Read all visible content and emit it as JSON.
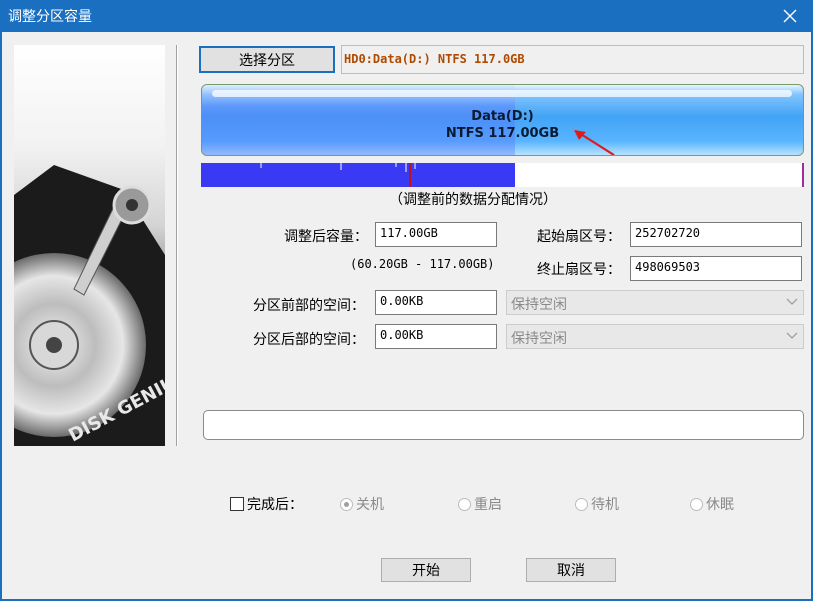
{
  "window": {
    "title": "调整分区容量"
  },
  "toolbar": {
    "select_partition_label": "选择分区"
  },
  "partition": {
    "info": "HD0:Data(D:) NTFS 117.0GB",
    "name": "Data(D:)",
    "fs_size": "NTFS 117.00GB",
    "used_fraction": 0.52
  },
  "map": {
    "caption": "（调整前的数据分配情况）"
  },
  "side": {
    "brand_text": "DISK GENIUS"
  },
  "form": {
    "size_label": "调整后容量：",
    "size_value": "117.00GB",
    "size_range": "(60.20GB - 117.00GB)",
    "start_sector_label": "起始扇区号：",
    "start_sector_value": "252702720",
    "end_sector_label": "终止扇区号：",
    "end_sector_value": "498069503",
    "before_label": "分区前部的空间：",
    "before_value": "0.00KB",
    "before_option": "保持空闲",
    "after_label": "分区后部的空间：",
    "after_value": "0.00KB",
    "after_option": "保持空闲"
  },
  "completion": {
    "checkbox_label": "完成后：",
    "options": [
      "关机",
      "重启",
      "待机",
      "休眠"
    ]
  },
  "buttons": {
    "start": "开始",
    "cancel": "取消"
  },
  "colors": {
    "titlebar": "#1a6fc1",
    "map_fill": "#3a3af5",
    "info_text": "#b04a00"
  }
}
